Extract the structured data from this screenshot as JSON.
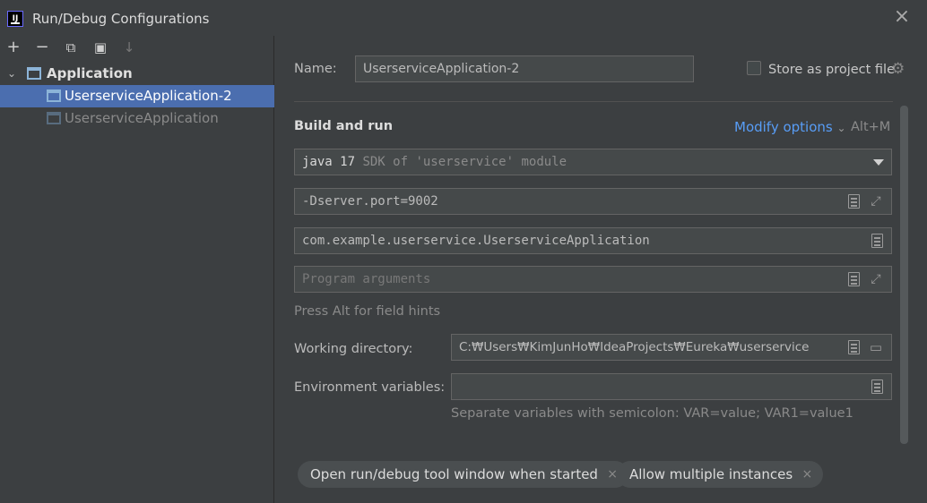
{
  "window": {
    "title": "Run/Debug Configurations",
    "close_glyph": "×"
  },
  "toolbar": {
    "add": "+",
    "remove": "−",
    "copy": "⧉",
    "folder": "▣",
    "sort": "↓"
  },
  "tree": {
    "group_label": "Application",
    "items": [
      {
        "label": "UserserviceApplication-2",
        "selected": true
      },
      {
        "label": "UserserviceApplication",
        "selected": false
      }
    ]
  },
  "form": {
    "name_label": "Name:",
    "name_value": "UserserviceApplication-2",
    "store_label": "Store as project file",
    "section_title": "Build and run",
    "modify_options": "Modify options",
    "modify_shortcut": "Alt+M",
    "sdk_bold": "java 17",
    "sdk_rest": "SDK of 'userservice' module",
    "vm_options": "-Dserver.port=9002",
    "main_class": "com.example.userservice.UserserviceApplication",
    "program_args_placeholder": "Program arguments",
    "field_hint": "Press Alt for field hints",
    "working_dir_label": "Working directory:",
    "working_dir_value": "C:₩Users₩KimJunHo₩IdeaProjects₩Eureka₩userservice",
    "env_label": "Environment variables:",
    "env_value": "",
    "env_hint": "Separate variables with semicolon: VAR=value; VAR1=value1"
  },
  "chips": [
    {
      "label": "Open run/debug tool window when started"
    },
    {
      "label": "Allow multiple instances"
    }
  ],
  "icons": {
    "app": "intellij-icon",
    "gear": "gear-icon",
    "doc": "document-icon",
    "expand": "expand-icon",
    "folder": "folder-icon",
    "chip_close": "×"
  }
}
